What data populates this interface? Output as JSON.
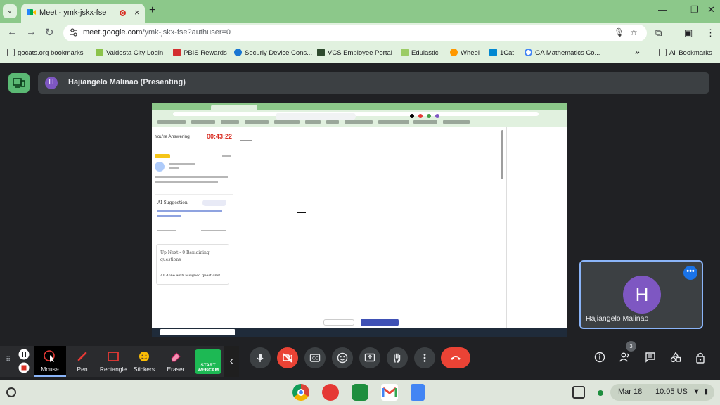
{
  "browser": {
    "tab_title": "Meet - ymk-jskx-fse",
    "url_host": "meet.google.com",
    "url_path": "/ymk-jskx-fse?authuser=0",
    "bookmarks": [
      {
        "label": "gocats.org bookmarks",
        "icon": "folder-icon"
      },
      {
        "label": "Valdosta City Login",
        "icon": "green-check-icon"
      },
      {
        "label": "PBIS Rewards",
        "icon": "pbis-icon"
      },
      {
        "label": "Securly Device Cons...",
        "icon": "securly-icon"
      },
      {
        "label": "VCS Employee Portal",
        "icon": "vcs-icon"
      },
      {
        "label": "Edulastic",
        "icon": "edulastic-icon"
      },
      {
        "label": "Wheel",
        "icon": "wheel-icon"
      },
      {
        "label": "1Cat",
        "icon": "cat-icon"
      },
      {
        "label": "GA Mathematics Co...",
        "icon": "google-icon"
      }
    ],
    "all_bookmarks": "All Bookmarks",
    "more_bookmarks": "»"
  },
  "meet": {
    "presenter_initial": "H",
    "presenter_label": "Hajiangelo Malinao (Presenting)",
    "self_initial": "H",
    "self_name": "Hajiangelo Malinao",
    "participant_count": "3"
  },
  "shared_screen": {
    "answering": "You're Answering",
    "timer": "00:43:22",
    "ai_suggestion": "AI Suggestion",
    "up_next": "Up Next - 0 Remaining questions",
    "caught_up": "All done with assigned questions!"
  },
  "screencast": {
    "tools": [
      {
        "label": "Mouse",
        "icon": "mouse-pointer-icon",
        "active": true
      },
      {
        "label": "Pen",
        "icon": "pen-icon"
      },
      {
        "label": "Rectangle",
        "icon": "rectangle-icon"
      },
      {
        "label": "Stickers",
        "icon": "sticker-icon"
      },
      {
        "label": "Eraser",
        "icon": "eraser-icon"
      }
    ],
    "webcam_label": "START WEBCAM"
  },
  "shelf": {
    "date": "Mar 18",
    "time": "10:05",
    "locale": "US"
  },
  "colors": {
    "chrome_frame": "#8cc88a",
    "toolbar": "#e1f1df",
    "meet_bg": "#202124",
    "avatar": "#7e57c2",
    "danger": "#ea4335",
    "webcam": "#1db954"
  }
}
